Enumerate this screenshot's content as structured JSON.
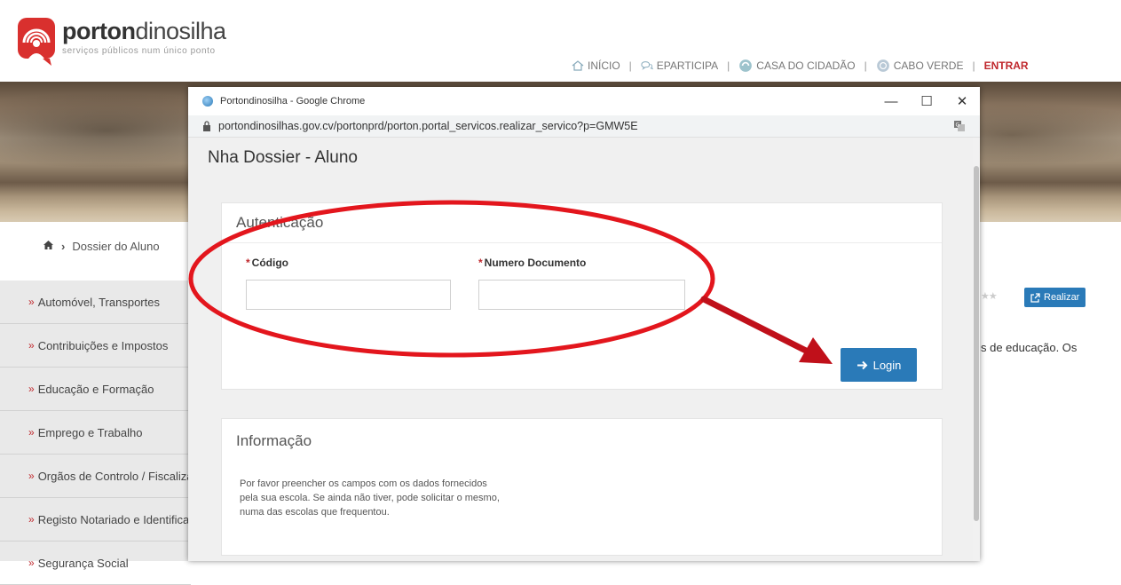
{
  "site": {
    "logo_bold": "porton",
    "logo_rest": "dinosilha",
    "tagline": "serviços públicos num único ponto",
    "nav": [
      {
        "label": "INÍCIO",
        "icon": "home-icon"
      },
      {
        "label": "EPARTICIPA",
        "icon": "chat-icon"
      },
      {
        "label": "CASA DO CIDADÃO",
        "icon": "citizen-icon"
      },
      {
        "label": "CABO VERDE",
        "icon": "flag-icon"
      }
    ],
    "login_link": "ENTRAR",
    "breadcrumb": "Dossier do Aluno",
    "sidebar": [
      "Automóvel, Transportes",
      "Contribuições e Impostos",
      "Educação e Formação",
      "Emprego e Trabalho",
      "Orgãos de Controlo / Fiscalização",
      "Registo Notariado e Identificação",
      "Segurança Social"
    ],
    "realizar_label": "Realizar",
    "description_fragment": "s de educação. Os",
    "brand_color": "#c0282d",
    "accent_color": "#2a7ab8"
  },
  "popup": {
    "window_title": "Portondinosilha - Google Chrome",
    "url": "portondinosilhas.gov.cv/portonprd/porton.portal_servicos.realizar_servico?p=GMW5E",
    "page_title": "Nha Dossier - Aluno",
    "auth": {
      "heading": "Autenticação",
      "codigo_label": "Código",
      "codigo_value": "",
      "documento_label": "Numero Documento",
      "documento_value": "",
      "required_mark": "*",
      "login_label": "Login"
    },
    "info": {
      "heading": "Informação",
      "text_lines": [
        "Por favor preencher os campos com os dados fornecidos",
        "pela sua escola. Se ainda não tiver, pode solicitar o mesmo,",
        "numa das escolas que frequentou."
      ]
    }
  },
  "annotation": {
    "ellipse_color": "#e3161d",
    "arrow_color": "#c0101a"
  }
}
